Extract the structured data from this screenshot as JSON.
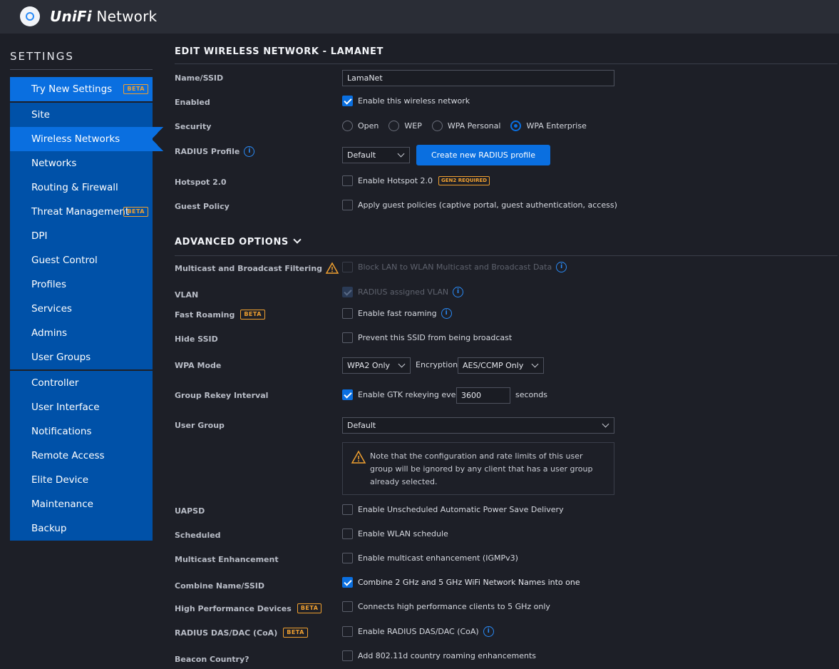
{
  "app": {
    "brand_unifi": "UniFi",
    "brand_network": "Network"
  },
  "sidebar": {
    "title": "SETTINGS",
    "beta_label": "BETA",
    "try_new": "Try New Settings",
    "items": [
      {
        "label": "Site"
      },
      {
        "label": "Wireless Networks"
      },
      {
        "label": "Networks"
      },
      {
        "label": "Routing & Firewall"
      },
      {
        "label": "Threat Management"
      },
      {
        "label": "DPI"
      },
      {
        "label": "Guest Control"
      },
      {
        "label": "Profiles"
      },
      {
        "label": "Services"
      },
      {
        "label": "Admins"
      },
      {
        "label": "User Groups"
      },
      {
        "label": "Controller"
      },
      {
        "label": "User Interface"
      },
      {
        "label": "Notifications"
      },
      {
        "label": "Remote Access"
      },
      {
        "label": "Elite Device"
      },
      {
        "label": "Maintenance"
      },
      {
        "label": "Backup"
      }
    ]
  },
  "form": {
    "title": "EDIT WIRELESS NETWORK - LAMANET",
    "name_label": "Name/SSID",
    "name_value": "LamaNet",
    "enabled_label": "Enabled",
    "enabled_text": "Enable this wireless network",
    "security_label": "Security",
    "security_options": [
      "Open",
      "WEP",
      "WPA Personal",
      "WPA Enterprise"
    ],
    "security_selected": "WPA Enterprise",
    "radius_label": "RADIUS Profile",
    "radius_value": "Default",
    "radius_button": "Create new RADIUS profile",
    "hotspot_label": "Hotspot 2.0",
    "hotspot_text": "Enable Hotspot 2.0",
    "gen2_badge": "GEN2 REQUIRED",
    "guest_label": "Guest Policy",
    "guest_text": "Apply guest policies (captive portal, guest authentication, access)"
  },
  "advanced": {
    "title": "ADVANCED OPTIONS",
    "multicast_label": "Multicast and Broadcast Filtering",
    "multicast_text": "Block LAN to WLAN Multicast and Broadcast Data",
    "vlan_label": "VLAN",
    "vlan_text": "RADIUS assigned VLAN",
    "fast_roaming_label": "Fast Roaming",
    "fast_roaming_text": "Enable fast roaming",
    "hide_ssid_label": "Hide SSID",
    "hide_ssid_text": "Prevent this SSID from being broadcast",
    "wpa_mode_label": "WPA Mode",
    "wpa_mode_value": "WPA2 Only",
    "encryption_label": "Encryption",
    "encryption_value": "AES/CCMP Only",
    "rekey_label": "Group Rekey Interval",
    "rekey_text": "Enable GTK rekeying every",
    "rekey_value": "3600",
    "rekey_unit": "seconds",
    "user_group_label": "User Group",
    "user_group_value": "Default",
    "user_group_note": "Note that the configuration and rate limits of this user group will be ignored by any client that has a user group already selected.",
    "uapsd_label": "UAPSD",
    "uapsd_text": "Enable Unscheduled Automatic Power Save Delivery",
    "scheduled_label": "Scheduled",
    "scheduled_text": "Enable WLAN schedule",
    "mc_enh_label": "Multicast Enhancement",
    "mc_enh_text": "Enable multicast enhancement (IGMPv3)",
    "combine_label": "Combine Name/SSID",
    "combine_text": "Combine 2 GHz and 5 GHz WiFi Network Names into one",
    "hpd_label": "High Performance Devices",
    "hpd_text": "Connects high performance clients to 5 GHz only",
    "das_label": "RADIUS DAS/DAC (CoA)",
    "das_text": "Enable RADIUS DAS/DAC (CoA)",
    "beacon_label": "Beacon Country?",
    "beacon_text": "Add 802.11d country roaming enhancements"
  },
  "colors": {
    "accent": "#0a6fe0",
    "sidebar": "#0051a8",
    "background": "#1d1f27",
    "beta": "#f0a030"
  }
}
